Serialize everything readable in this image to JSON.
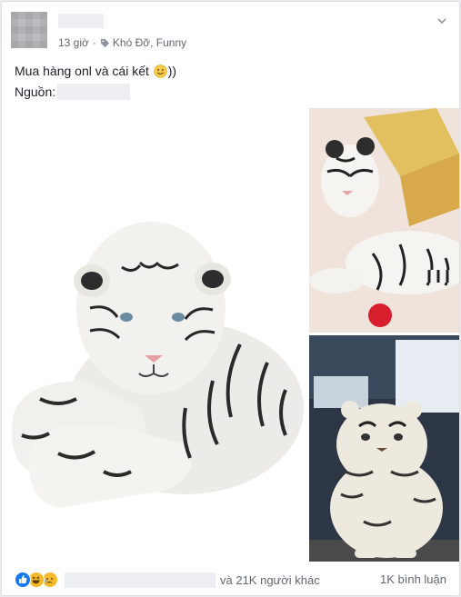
{
  "post": {
    "time": "13 giờ",
    "tags": "Khó Đỡ, Funny",
    "text_main": "Mua hàng onl và cái kết ",
    "text_tail": "))",
    "source_label": "Nguồn:"
  },
  "footer": {
    "reactions_suffix": "và 21K người khác",
    "comments": "1K bình luận"
  },
  "icons": {
    "tag": "tag-icon",
    "menu": "chevron-down-icon",
    "emoji": "smile-emoji-icon",
    "reactions": [
      "like-icon",
      "haha-icon",
      "sad-icon"
    ]
  },
  "colors": {
    "like": "#1877f2",
    "haha": "#f7b928",
    "meta_text": "#616770",
    "body_text": "#1d2129"
  }
}
